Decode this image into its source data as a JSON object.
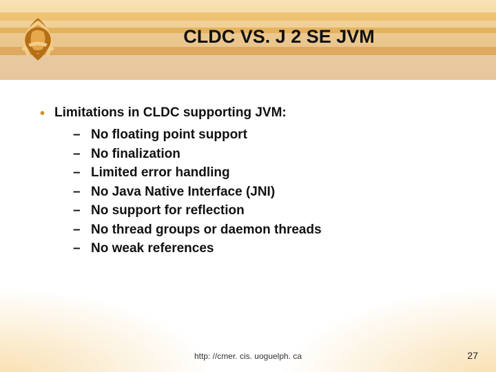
{
  "title": "CLDC VS. J 2 SE JVM",
  "main_bullet": "Limitations in CLDC supporting JVM:",
  "sub_bullets": [
    "No floating point support",
    "No finalization",
    "Limited error handling",
    "No Java Native Interface (JNI)",
    "No support for reflection",
    "No thread groups or daemon threads",
    "No weak references"
  ],
  "footer_url": "http: //cmer. cis. uoguelph. ca",
  "page_number": "27",
  "colors": {
    "accent": "#d48f2a"
  },
  "icons": {
    "logo": "triquetra-knot-icon"
  }
}
